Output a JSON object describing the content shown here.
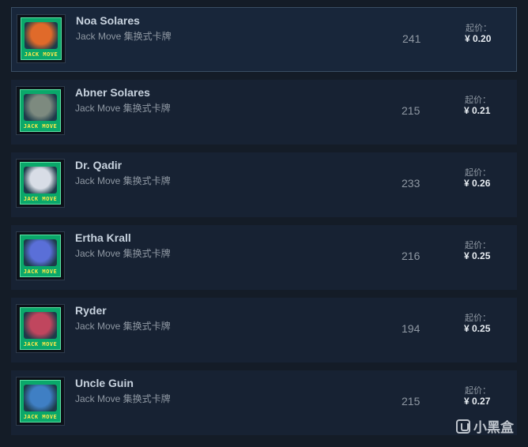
{
  "listings": [
    {
      "name": "Noa Solares",
      "game": "Jack Move 集换式卡牌",
      "quantity": "241",
      "price_label": "起价：",
      "price": "¥ 0.20",
      "portrait_color": "#e06a2a",
      "card_text": "JACK MOVE",
      "highlight": true
    },
    {
      "name": "Abner Solares",
      "game": "Jack Move 集换式卡牌",
      "quantity": "215",
      "price_label": "起价：",
      "price": "¥ 0.21",
      "portrait_color": "#7d8a7f",
      "card_text": "JACK MOVE",
      "highlight": false
    },
    {
      "name": "Dr. Qadir",
      "game": "Jack Move 集换式卡牌",
      "quantity": "233",
      "price_label": "起价：",
      "price": "¥ 0.26",
      "portrait_color": "#d8dde6",
      "card_text": "JACK MOVE",
      "highlight": false
    },
    {
      "name": "Ertha Krall",
      "game": "Jack Move 集换式卡牌",
      "quantity": "216",
      "price_label": "起价：",
      "price": "¥ 0.25",
      "portrait_color": "#5a6fd8",
      "card_text": "JACK MOVE",
      "highlight": false
    },
    {
      "name": "Ryder",
      "game": "Jack Move 集换式卡牌",
      "quantity": "194",
      "price_label": "起价：",
      "price": "¥ 0.25",
      "portrait_color": "#c0465e",
      "card_text": "JACK MOVE",
      "highlight": false
    },
    {
      "name": "Uncle Guin",
      "game": "Jack Move 集换式卡牌",
      "quantity": "215",
      "price_label": "起价：",
      "price": "¥ 0.27",
      "portrait_color": "#3f7fc4",
      "card_text": "JACK MOVE",
      "highlight": false
    }
  ],
  "watermark": {
    "text": "小黑盒"
  }
}
